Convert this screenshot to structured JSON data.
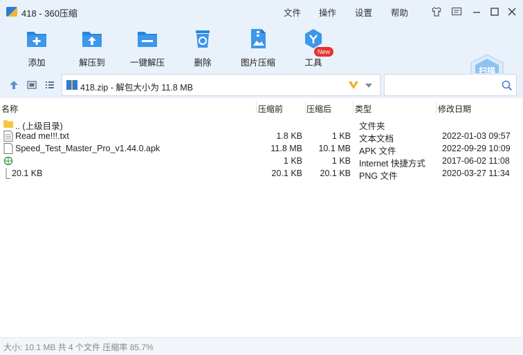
{
  "window": {
    "title": "418 - 360压缩"
  },
  "menu": [
    "文件",
    "操作",
    "设置",
    "帮助"
  ],
  "toolbar": {
    "items": [
      {
        "label": "添加",
        "icon": "add-icon"
      },
      {
        "label": "解压到",
        "icon": "extract-to-icon"
      },
      {
        "label": "一键解压",
        "icon": "one-click-extract-icon"
      },
      {
        "label": "删除",
        "icon": "delete-icon"
      },
      {
        "label": "图片压缩",
        "icon": "image-compress-icon"
      },
      {
        "label": "工具",
        "icon": "tools-icon"
      }
    ],
    "new_badge": "New",
    "scan_label": "扫描"
  },
  "address": {
    "path": "418.zip - 解包大小为 11.8 MB",
    "search_placeholder": ""
  },
  "columns": [
    "名称",
    "压缩前",
    "压缩后",
    "类型",
    "修改日期"
  ],
  "files": [
    {
      "name": ".. (上级目录)",
      "before": "",
      "after": "",
      "type": "文件夹",
      "date": "",
      "icon": "folder-icon"
    },
    {
      "name": "Read me!!!.txt",
      "before": "1.8 KB",
      "after": "1 KB",
      "type": "文本文档",
      "date": "2022-01-03 09:57",
      "icon": "text-file-icon"
    },
    {
      "name": "Speed_Test_Master_Pro_v1.44.0.apk",
      "before": "11.8 MB",
      "after": "10.1 MB",
      "type": "APK 文件",
      "date": "2022-09-29 10:09",
      "icon": "apk-file-icon"
    },
    {
      "name": "",
      "before": "1 KB",
      "after": "1 KB",
      "type": "Internet 快捷方式",
      "date": "2017-06-02 11:08",
      "icon": "internet-shortcut-icon"
    },
    {
      "name": "20.1 KB",
      "before": "20.1 KB",
      "after": "20.1 KB",
      "type": "PNG 文件",
      "date": "2020-03-27 11:34",
      "icon": "png-file-icon"
    }
  ],
  "status": {
    "text": "大小: 10.1 MB 共 4 个文件 压缩率 85.7%"
  }
}
